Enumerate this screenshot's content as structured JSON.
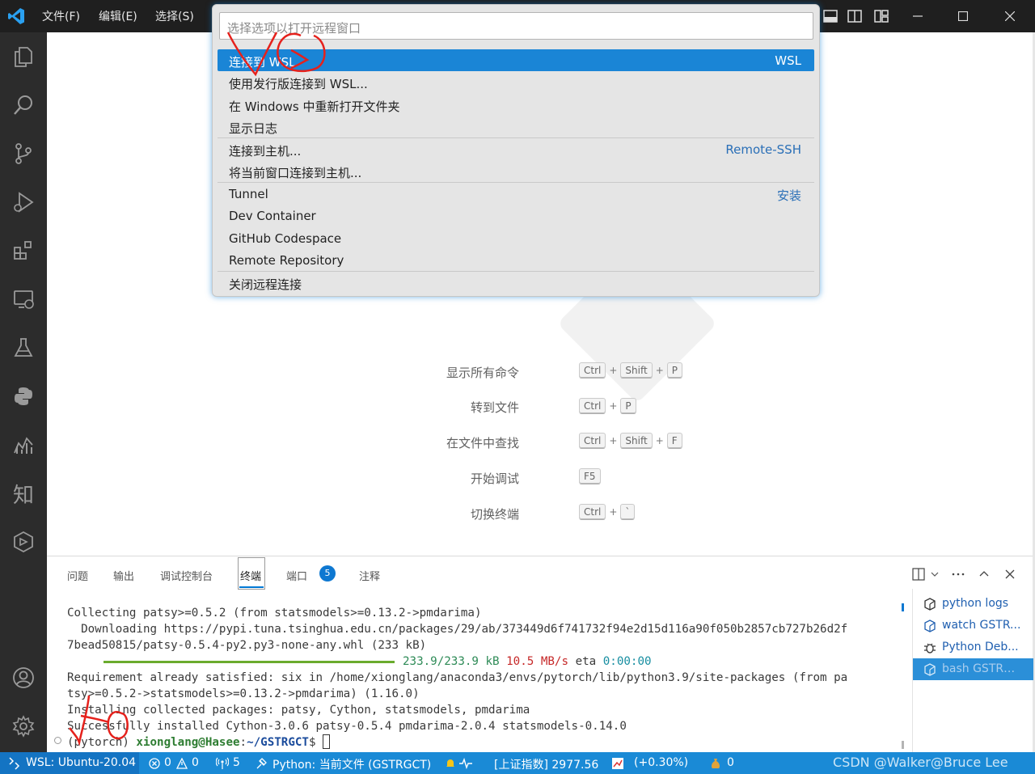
{
  "app": {
    "menu": [
      "文件(F)",
      "编辑(E)",
      "选择(S)"
    ]
  },
  "quickpick": {
    "placeholder": "选择选项以打开远程窗口",
    "items": [
      {
        "label": "连接到 WSL",
        "desc": "WSL",
        "selected": true
      },
      {
        "label": "使用发行版连接到 WSL...",
        "desc": ""
      },
      {
        "label": "在 Windows 中重新打开文件夹",
        "desc": ""
      },
      {
        "label": "显示日志",
        "desc": ""
      },
      {
        "label": "连接到主机...",
        "desc": "Remote-SSH"
      },
      {
        "label": "将当前窗口连接到主机...",
        "desc": ""
      },
      {
        "label": "Tunnel",
        "desc": "安装"
      },
      {
        "label": "Dev Container",
        "desc": ""
      },
      {
        "label": "GitHub Codespace",
        "desc": ""
      },
      {
        "label": "Remote Repository",
        "desc": ""
      },
      {
        "label": "关闭远程连接",
        "desc": ""
      }
    ]
  },
  "shortcuts": [
    {
      "label": "显示所有命令",
      "keys": [
        "Ctrl",
        "Shift",
        "P"
      ]
    },
    {
      "label": "转到文件",
      "keys": [
        "Ctrl",
        "P"
      ]
    },
    {
      "label": "在文件中查找",
      "keys": [
        "Ctrl",
        "Shift",
        "F"
      ]
    },
    {
      "label": "开始调试",
      "keys": [
        "F5"
      ]
    },
    {
      "label": "切换终端",
      "keys": [
        "Ctrl",
        "`"
      ]
    }
  ],
  "activity": {
    "zhi_label": "知"
  },
  "panel": {
    "tabs": [
      "问题",
      "输出",
      "调试控制台",
      "终端",
      "端口",
      "注释"
    ],
    "ports_badge": "5"
  },
  "terminal": {
    "line1": "Collecting patsy>=0.5.2 (from statsmodels>=0.13.2->pmdarima)",
    "line2": "  Downloading https://pypi.tuna.tsinghua.edu.cn/packages/29/ab/373449d6f741732f94e2d15d116a90f050b2857cb727b26d2f",
    "line3": "7bead50815/patsy-0.5.4-py2.py3-none-any.whl (233 kB)",
    "progress_size": "233.9/233.9 kB",
    "progress_speed": "10.5 MB/s",
    "progress_eta_label": "eta",
    "progress_eta": "0:00:00",
    "progress_fraction": 1.0,
    "line5": "Requirement already satisfied: six in /home/xionglang/anaconda3/envs/pytorch/lib/python3.9/site-packages (from pa",
    "line6": "tsy>=0.5.2->statsmodels>=0.13.2->pmdarima) (1.16.0)",
    "line7": "Installing collected packages: patsy, Cython, statsmodels, pmdarima",
    "line8": "Successfully installed Cython-3.0.6 patsy-0.5.4 pmdarima-2.0.4 statsmodels-0.14.0",
    "prompt_env": "(pytorch) ",
    "prompt_user": "xionglang@Hasee",
    "prompt_sep": ":",
    "prompt_path": "~/GSTRGCT",
    "prompt_end": "$ "
  },
  "terminal_list": [
    {
      "label": "python logs"
    },
    {
      "label": "watch GSTR..."
    },
    {
      "label": "Python Deb..."
    },
    {
      "label": "bash GSTRG...",
      "selected": true
    }
  ],
  "statusbar": {
    "remote": "WSL: Ubuntu-20.04",
    "errors": "0",
    "warnings": "0",
    "ports": "5",
    "python": "Python: 当前文件 (GSTRGCT)",
    "stock": "[上证指数] 2977.56",
    "change": "(+0.30%)",
    "coins": "0",
    "watermark": "CSDN @Walker@Bruce Lee"
  },
  "colors": {
    "statusbar": "#1a8ad6",
    "selection": "#1a85d6",
    "titlebar": "#1f1f1f",
    "activitybar": "#2c2c2c"
  }
}
